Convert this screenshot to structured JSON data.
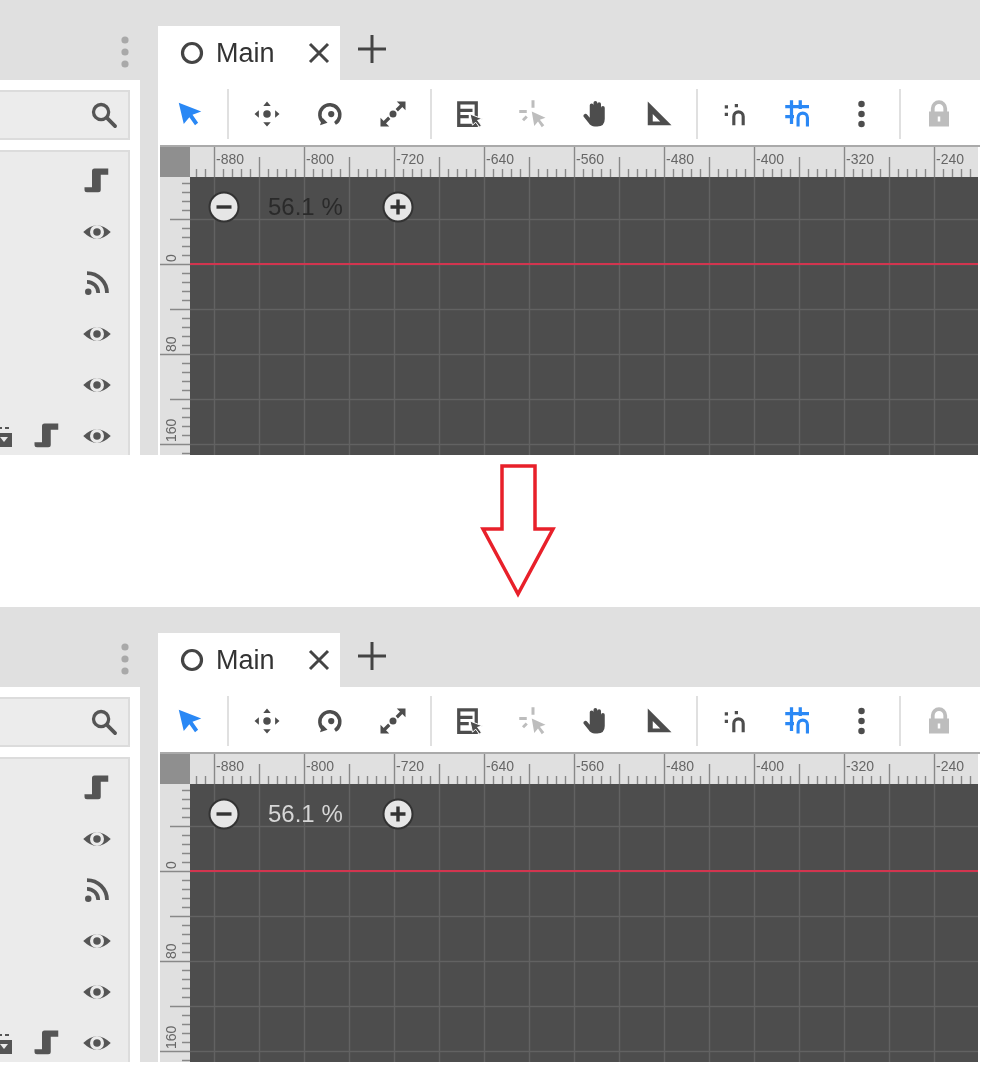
{
  "panels": [
    {
      "tab": {
        "label": "Main",
        "selected": true
      },
      "toolbar": {
        "groups": [
          {
            "tools": [
              {
                "kind": "select",
                "active": true,
                "disabled": false
              }
            ]
          },
          {
            "tools": [
              {
                "kind": "move",
                "active": false,
                "disabled": false
              },
              {
                "kind": "rotate",
                "active": false,
                "disabled": false
              },
              {
                "kind": "scale",
                "active": false,
                "disabled": false
              }
            ]
          },
          {
            "tools": [
              {
                "kind": "list_select",
                "active": false,
                "disabled": false
              },
              {
                "kind": "cursor",
                "active": false,
                "disabled": true
              },
              {
                "kind": "pan",
                "active": false,
                "disabled": false
              },
              {
                "kind": "ruler",
                "active": false,
                "disabled": false
              }
            ]
          },
          {
            "tools": [
              {
                "kind": "snap",
                "active": false,
                "disabled": false
              },
              {
                "kind": "grid_snap",
                "active": true,
                "disabled": false
              },
              {
                "kind": "more",
                "active": false,
                "disabled": false
              }
            ]
          },
          {
            "tools": [
              {
                "kind": "lock",
                "active": false,
                "disabled": true
              }
            ]
          }
        ]
      },
      "ruler": {
        "x_labels": [
          "-880",
          "-800",
          "-720",
          "-640",
          "-560",
          "-480",
          "-400",
          "-320",
          "-240"
        ],
        "y_labels": [
          "0",
          "80",
          "160"
        ]
      },
      "zoom": {
        "label": "56.1 %",
        "dimmed": true
      }
    },
    {
      "tab": {
        "label": "Main",
        "selected": true
      },
      "toolbar": {
        "groups": [
          {
            "tools": [
              {
                "kind": "select",
                "active": true,
                "disabled": false
              }
            ]
          },
          {
            "tools": [
              {
                "kind": "move",
                "active": false,
                "disabled": false
              },
              {
                "kind": "rotate",
                "active": false,
                "disabled": false
              },
              {
                "kind": "scale",
                "active": false,
                "disabled": false
              }
            ]
          },
          {
            "tools": [
              {
                "kind": "list_select",
                "active": false,
                "disabled": false
              },
              {
                "kind": "cursor",
                "active": false,
                "disabled": true
              },
              {
                "kind": "pan",
                "active": false,
                "disabled": false
              },
              {
                "kind": "ruler",
                "active": false,
                "disabled": false
              }
            ]
          },
          {
            "tools": [
              {
                "kind": "snap",
                "active": false,
                "disabled": false
              },
              {
                "kind": "grid_snap",
                "active": true,
                "disabled": false
              },
              {
                "kind": "more",
                "active": false,
                "disabled": false
              }
            ]
          },
          {
            "tools": [
              {
                "kind": "lock",
                "active": false,
                "disabled": true
              }
            ]
          }
        ]
      },
      "ruler": {
        "x_labels": [
          "-880",
          "-800",
          "-720",
          "-640",
          "-560",
          "-480",
          "-400",
          "-320",
          "-240"
        ],
        "y_labels": [
          "0",
          "80",
          "160"
        ]
      },
      "zoom": {
        "label": "56.1 %",
        "dimmed": false
      }
    }
  ]
}
